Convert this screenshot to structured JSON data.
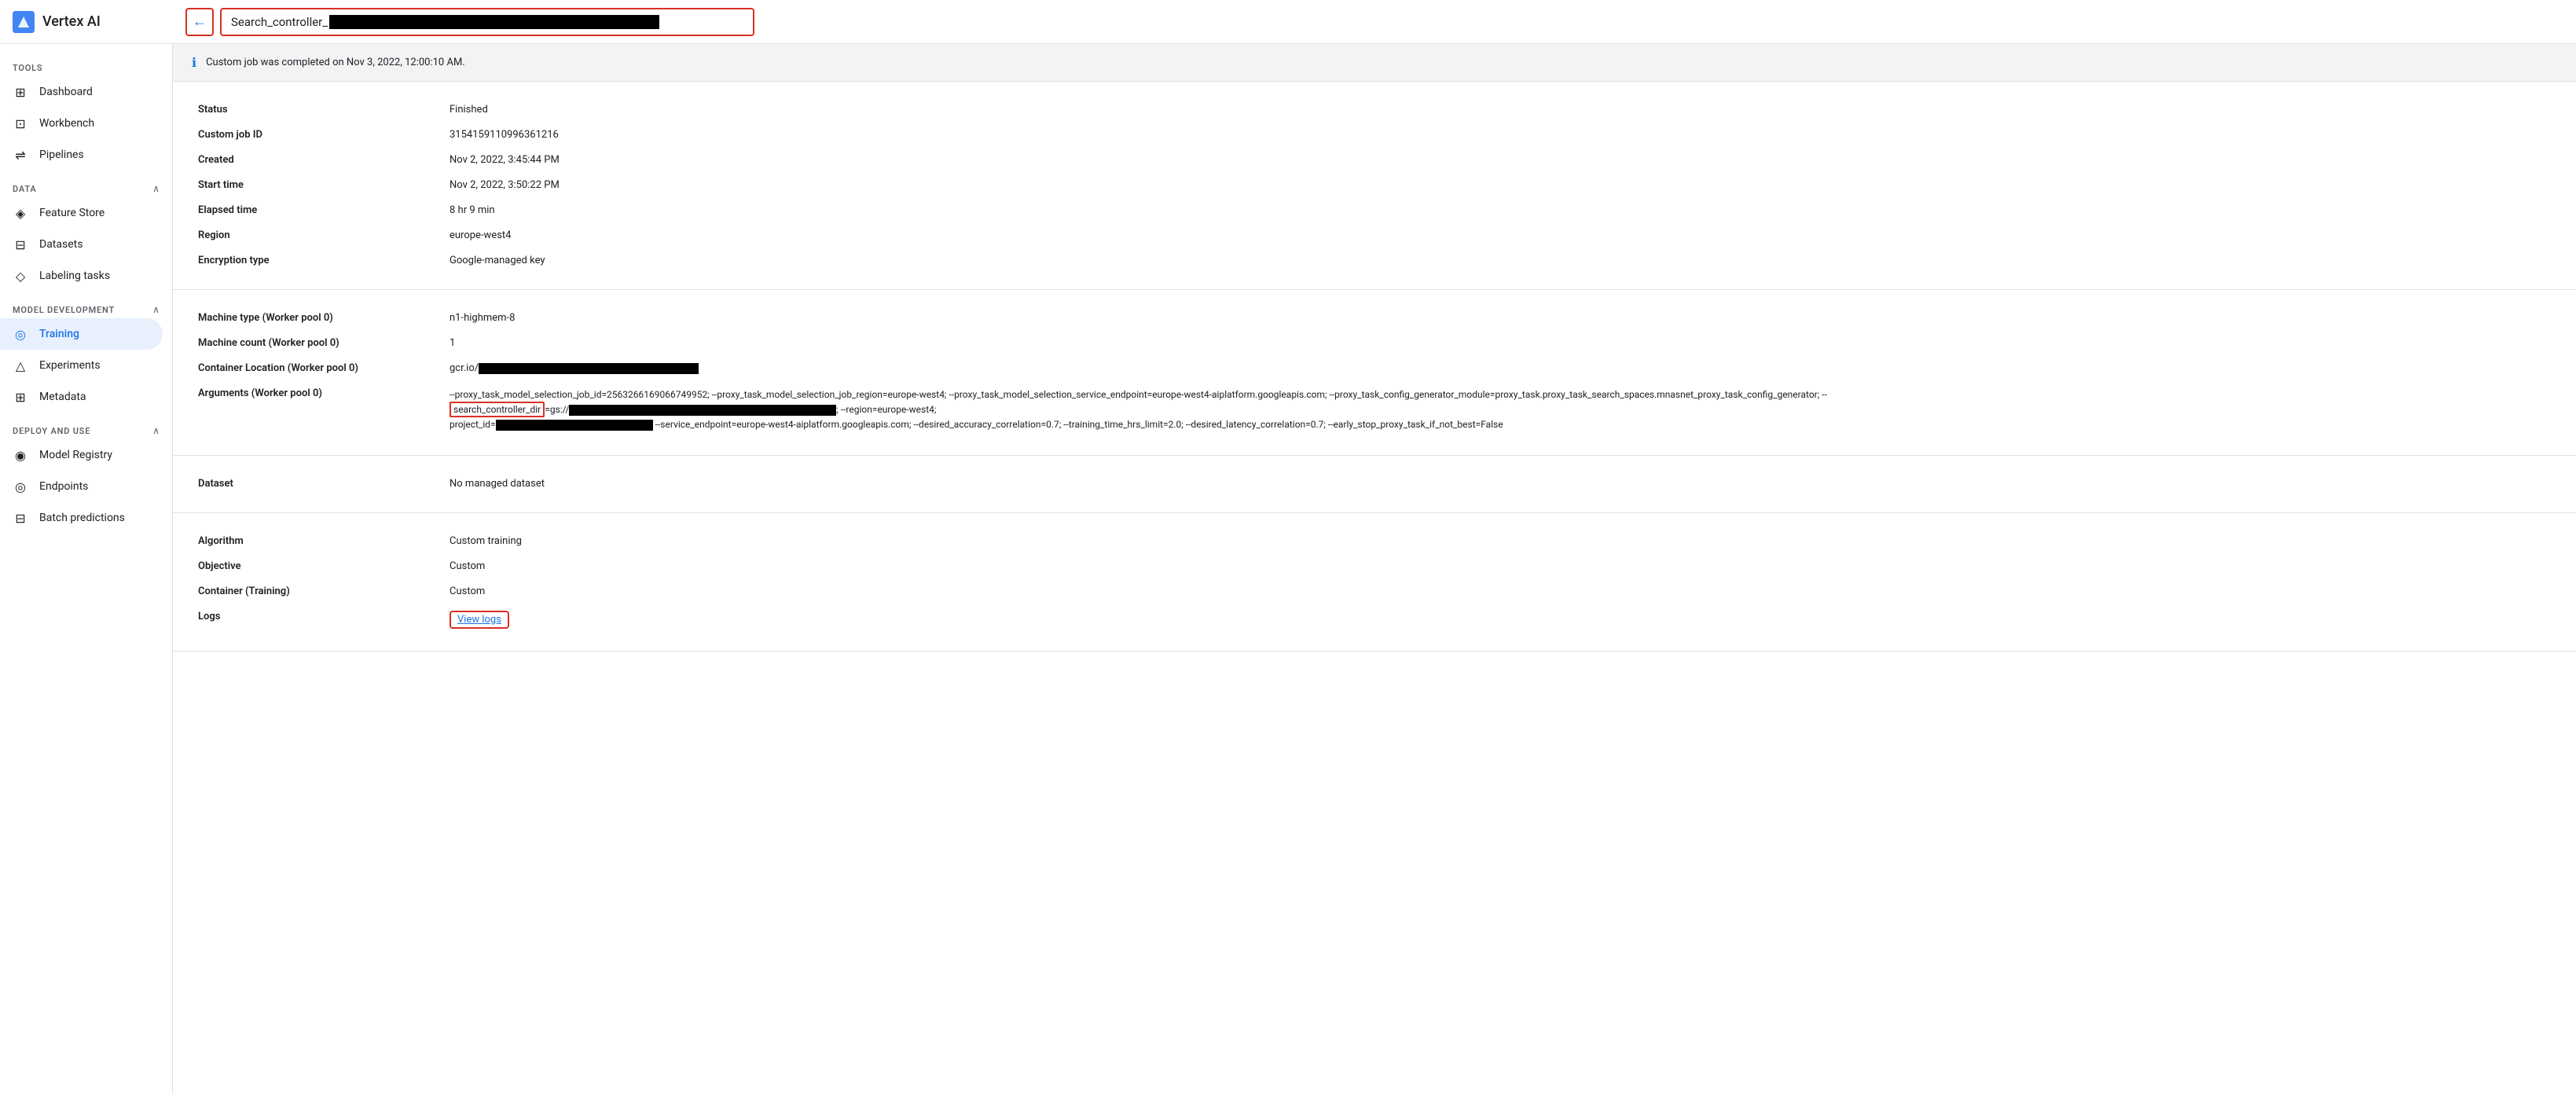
{
  "topbar": {
    "logo": "Vertex AI",
    "back_label": "←",
    "title_prefix": "Search_controller_"
  },
  "sidebar": {
    "tools_label": "TOOLS",
    "tools_items": [
      {
        "id": "dashboard",
        "label": "Dashboard",
        "icon": "⊞"
      },
      {
        "id": "workbench",
        "label": "Workbench",
        "icon": "⊡"
      },
      {
        "id": "pipelines",
        "label": "Pipelines",
        "icon": "⇌"
      }
    ],
    "data_label": "DATA",
    "data_items": [
      {
        "id": "feature-store",
        "label": "Feature Store",
        "icon": "◈"
      },
      {
        "id": "datasets",
        "label": "Datasets",
        "icon": "⊟"
      },
      {
        "id": "labeling-tasks",
        "label": "Labeling tasks",
        "icon": "◇"
      }
    ],
    "model_label": "MODEL DEVELOPMENT",
    "model_items": [
      {
        "id": "training",
        "label": "Training",
        "icon": "◎",
        "active": true
      },
      {
        "id": "experiments",
        "label": "Experiments",
        "icon": "△"
      },
      {
        "id": "metadata",
        "label": "Metadata",
        "icon": "⊞"
      }
    ],
    "deploy_label": "DEPLOY AND USE",
    "deploy_items": [
      {
        "id": "model-registry",
        "label": "Model Registry",
        "icon": "◉"
      },
      {
        "id": "endpoints",
        "label": "Endpoints",
        "icon": "◎"
      },
      {
        "id": "batch-predictions",
        "label": "Batch predictions",
        "icon": "⊟"
      }
    ]
  },
  "info_banner": {
    "text": "Custom job was completed on Nov 3, 2022, 12:00:10 AM."
  },
  "details": {
    "sections": [
      {
        "rows": [
          {
            "label": "Status",
            "value": "Finished"
          },
          {
            "label": "Custom job ID",
            "value": "31541591109963612​16"
          },
          {
            "label": "Created",
            "value": "Nov 2, 2022, 3:45:44 PM"
          },
          {
            "label": "Start time",
            "value": "Nov 2, 2022, 3:50:22 PM"
          },
          {
            "label": "Elapsed time",
            "value": "8 hr 9 min"
          },
          {
            "label": "Region",
            "value": "europe-west4"
          },
          {
            "label": "Encryption type",
            "value": "Google-managed key"
          }
        ]
      },
      {
        "rows": [
          {
            "label": "Machine type (Worker pool 0)",
            "value": "n1-highmem-8"
          },
          {
            "label": "Machine count (Worker pool 0)",
            "value": "1"
          },
          {
            "label": "Container Location (Worker pool 0)",
            "value": "gcr.io/",
            "has_redacted": true
          },
          {
            "label": "Arguments (Worker pool 0)",
            "value": "args",
            "is_args": true
          }
        ]
      },
      {
        "rows": [
          {
            "label": "Dataset",
            "value": "No managed dataset"
          }
        ]
      },
      {
        "rows": [
          {
            "label": "Algorithm",
            "value": "Custom training"
          },
          {
            "label": "Objective",
            "value": "Custom"
          },
          {
            "label": "Container (Training)",
            "value": "Custom"
          },
          {
            "label": "Logs",
            "value": "View logs",
            "is_link": true
          }
        ]
      }
    ]
  },
  "args": {
    "line1": "--proxy_task_model_selection_job_id=256326616906674995​2; --proxy_task_model_selection_job_region=europe-west4; --proxy_task_model_selection_service_endpoint=europe-west4-aiplatform.googleapis.com; --proxy_task_config_generator_module=proxy_task.proxy_task_search_spaces.mnasnet_proxy_task_config_generator; --",
    "line2_prefix": "search_controller_dir",
    "line2_middle": "=gs://",
    "line2_suffix": "; --region=europe-west4;",
    "line3_prefix": "project_id=",
    "line3_suffix": " --service_endpoint=europe-west4-aiplatform.googleapis.com; --desired_accuracy_correlation=0.7; --training_time_hrs_limit=2.0; --desired_latency_correlation=0.7; --early_stop_proxy_task_if_not_best=False"
  },
  "icons": {
    "info": "ℹ",
    "back": "←",
    "chevron_up": "∧",
    "chevron_down": "∨"
  }
}
